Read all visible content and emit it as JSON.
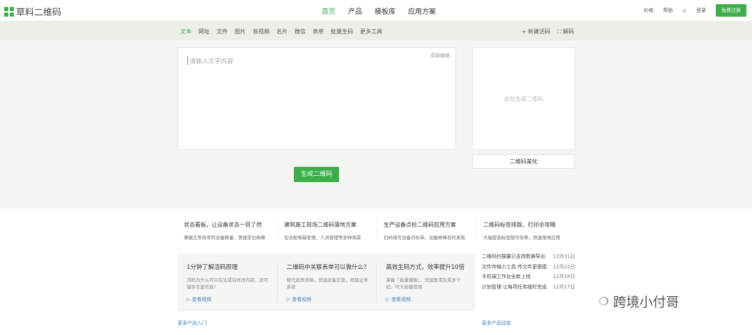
{
  "header": {
    "logo": "草料二维码",
    "nav": [
      "首页",
      "产品",
      "模板库",
      "应用方案"
    ],
    "right": [
      "价格",
      "帮助",
      "登录"
    ],
    "register": "免费注册"
  },
  "tabs": {
    "items": [
      "文本",
      "网址",
      "文件",
      "图片",
      "音视频",
      "名片",
      "微信",
      "表单",
      "批量生码",
      "更多工具"
    ],
    "new_live": "+ 新建活码",
    "decode": "⛶ 解码"
  },
  "editor": {
    "placeholder": "请输入文字内容",
    "advanced": "高级编辑"
  },
  "qr": {
    "placeholder": "此处生成二维码",
    "beautify": "二维码美化"
  },
  "generate": "生成二维码",
  "articles": [
    {
      "title": "状态看板，让设备状态一目了然",
      "desc": "掌握正常异常的设备数量，快速定位故障"
    },
    {
      "title": "建筑施工现场二维码落地方案",
      "desc": "包含配电箱管理、人员管理等多种场景"
    },
    {
      "title": "生产设备点检二维码应用方案",
      "desc": "扫码填写设备点检单，设备故障及时发现"
    },
    {
      "title": "二维码标签排版、打印全攻略",
      "desc": "大幅提高标签制作效率，快速落地应用"
    }
  ],
  "cards": [
    {
      "title": "1分钟了解活码原理",
      "desc": "活码为什么可以在生成后修改内容，还可储存丰富信息?",
      "link": "查看视频"
    },
    {
      "title": "二维码中关联表单可以做什么?",
      "desc": "替代纸质表格，快速收集信息，搭建业务系统",
      "link": "查看视频"
    },
    {
      "title": "高效生码方式，效率提升10倍",
      "desc": "掌握「批量模板」，快速复用生成多个码，可大规模使用",
      "link": "查看视频"
    }
  ],
  "news": [
    {
      "text": "二维码扫描量已支持数据导出",
      "date": "12月31日"
    },
    {
      "text": "文件传输小工具 传文件更便捷",
      "date": "12月22日"
    },
    {
      "text": "手机端工作台全新上线",
      "date": "12月18日"
    },
    {
      "text": "计划管理 让每项任务按时完成",
      "date": "12月17日"
    }
  ],
  "more_intro": "更多产品入门",
  "more_news": "更多产品动态",
  "watermark": "跨境小付哥"
}
